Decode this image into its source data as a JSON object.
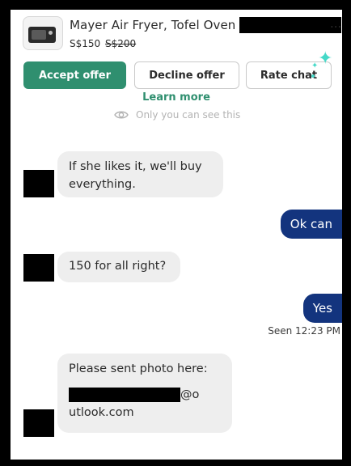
{
  "listing": {
    "title": "Mayer Air Fryer, Tofel Oven",
    "more": "...",
    "price": "S$150",
    "original_price": "S$200",
    "thumbnail_icon": "air-fryer-oven-image"
  },
  "actions": {
    "accept_label": "Accept offer",
    "decline_label": "Decline offer",
    "rate_label": "Rate chat",
    "learn_more": "Learn more",
    "privacy_note": "Only you can see this",
    "accent_color": "#2f8f6f",
    "sparkle_color": "#45d9c8"
  },
  "messages": [
    {
      "direction": "incoming",
      "text": "If she likes it, we'll buy everything."
    },
    {
      "direction": "outgoing",
      "text": "Ok can"
    },
    {
      "direction": "incoming",
      "text": "150 for all right?"
    },
    {
      "direction": "outgoing",
      "text": "Yes"
    },
    {
      "direction": "incoming",
      "line1": "Please sent photo here:",
      "email_suffix": "@o",
      "email_tail": "utlook.com"
    }
  ],
  "status": {
    "seen": "Seen 12:23 PM"
  },
  "colors": {
    "outgoing_bubble": "#13347e",
    "incoming_bubble": "#eeeeee"
  }
}
